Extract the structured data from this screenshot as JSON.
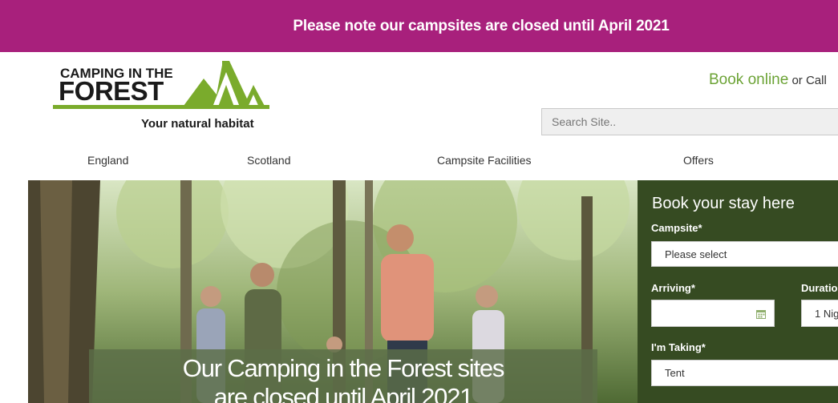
{
  "banner": {
    "text": "Please note our campsites are closed until April 2021"
  },
  "logo": {
    "line1": "CAMPING IN THE",
    "line2": "FOREST",
    "tagline": "Your natural habitat"
  },
  "header": {
    "book_online": "Book online",
    "or_call": " or Call"
  },
  "search": {
    "placeholder": "Search Site.."
  },
  "nav": {
    "items": [
      "England",
      "Scotland",
      "Campsite Facilities",
      "Offers"
    ]
  },
  "hero": {
    "caption_line1": "Our Camping in the Forest sites",
    "caption_line2": "are closed until April 2021"
  },
  "booking": {
    "title": "Book your stay here",
    "campsite_label": "Campsite*",
    "campsite_value": "Please select",
    "arriving_label": "Arriving*",
    "arriving_value": "",
    "duration_label": "Duratio",
    "duration_value": "1 Nig",
    "taking_label": "I'm Taking*",
    "taking_value": "Tent"
  },
  "colors": {
    "banner": "#a8207c",
    "brand_green": "#7aab2c",
    "panel_green": "#364b22",
    "link_green": "#6ca336"
  }
}
